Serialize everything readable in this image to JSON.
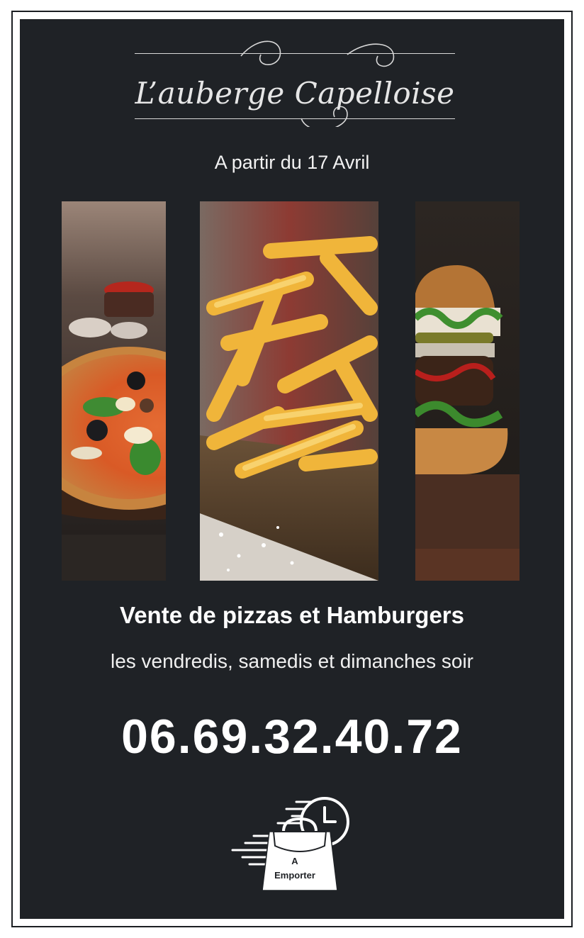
{
  "brand": {
    "name": "L’auberge Capelloise"
  },
  "announcement": {
    "start_date": "A partir du 17 Avril"
  },
  "gallery": {
    "items": [
      "pizza-photo",
      "fries-photo",
      "burger-photo"
    ]
  },
  "offer": {
    "headline": "Vente de pizzas et Hamburgers",
    "schedule": "les vendredis, samedis et dimanches soir"
  },
  "contact": {
    "phone": "06.69.32.40.72"
  },
  "takeaway": {
    "line1": "A",
    "line2": "Emporter",
    "icon": "takeaway-bag-clock-icon"
  },
  "colors": {
    "background": "#1f2226",
    "text": "#ffffff",
    "frame": "#1b1e22"
  }
}
